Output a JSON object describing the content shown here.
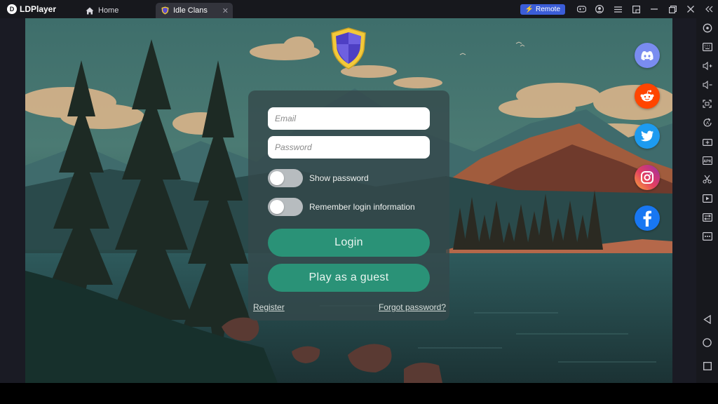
{
  "titlebar": {
    "app_name": "LDPlayer",
    "logo_glyph": "D",
    "tabs": [
      {
        "label": "Home",
        "icon": "home-icon"
      },
      {
        "label": "Idle Clans",
        "icon": "idle-clans-shield-icon",
        "active": true
      }
    ],
    "remote_label": "Remote",
    "remote_color": "#3b5dd8"
  },
  "login": {
    "email_placeholder": "Email",
    "password_placeholder": "Password",
    "show_password_label": "Show password",
    "show_password_on": false,
    "remember_label": "Remember login information",
    "remember_on": false,
    "login_label": "Login",
    "guest_label": "Play as a guest",
    "register_label": "Register",
    "forgot_label": "Forgot password?",
    "button_color": "#2a9277"
  },
  "social": [
    {
      "name": "discord",
      "icon": "discord-icon",
      "color": "#7a8cf0"
    },
    {
      "name": "reddit",
      "icon": "reddit-icon",
      "color": "#ff4500"
    },
    {
      "name": "twitter",
      "icon": "twitter-icon",
      "color": "#1d9bf0"
    },
    {
      "name": "instagram",
      "icon": "instagram-icon",
      "color": "#e4405f"
    },
    {
      "name": "facebook",
      "icon": "facebook-icon",
      "color": "#1877f2"
    }
  ],
  "sidebar": {
    "items": [
      "settings-icon",
      "keyboard-icon",
      "volume-up-icon",
      "volume-down-icon",
      "fullscreen-icon",
      "rotate-icon",
      "add-app-icon",
      "apk-icon",
      "scissors-icon",
      "record-icon",
      "sync-icon",
      "more-icon"
    ],
    "apk_text": "APK",
    "nav": [
      "back-icon",
      "home-circle-icon",
      "recent-apps-icon"
    ]
  }
}
